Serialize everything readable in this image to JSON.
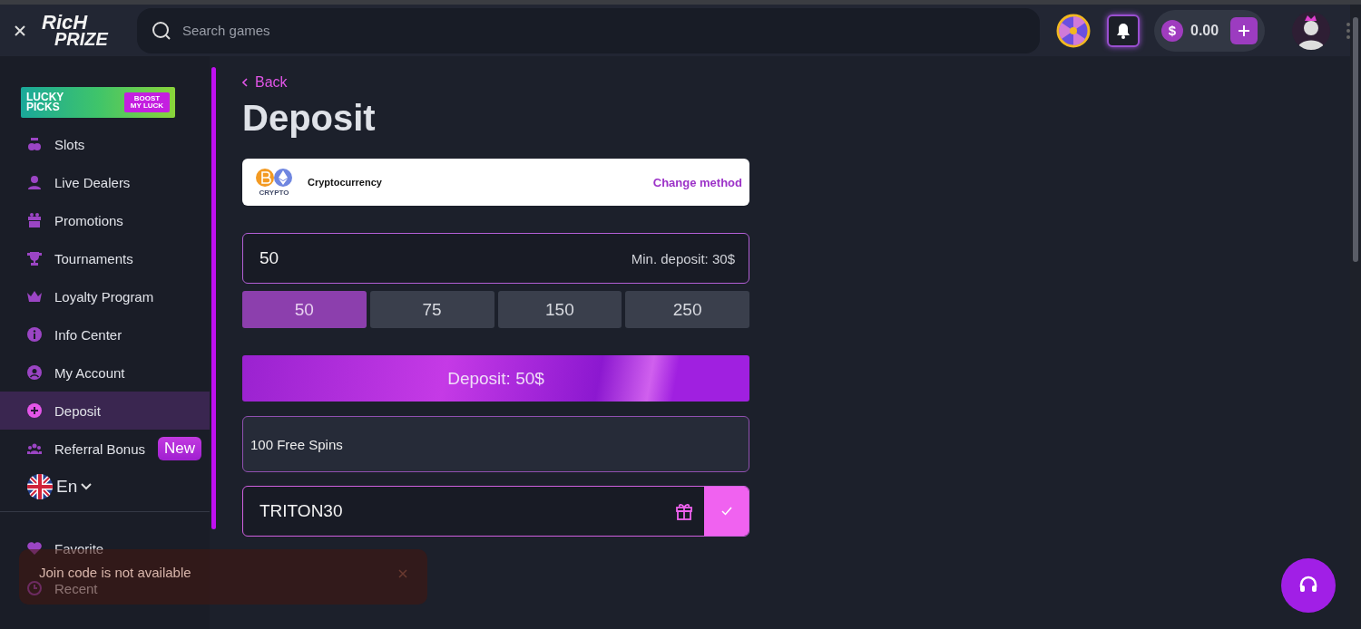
{
  "header": {
    "logo": [
      "RicH",
      "PRIZE"
    ],
    "search": {
      "placeholder": "Search games"
    },
    "currency_symbol": "$",
    "balance": "0.00"
  },
  "sidebar": {
    "banner": {
      "title": "LUCKY PICKS",
      "button": "BOOST MY LUCK"
    },
    "items": [
      {
        "label": "Slots",
        "selected": false
      },
      {
        "label": "Live Dealers",
        "selected": false
      },
      {
        "label": "Promotions",
        "selected": false
      },
      {
        "label": "Tournaments",
        "selected": false
      },
      {
        "label": "Loyalty Program",
        "selected": false
      },
      {
        "label": "Info Center",
        "selected": false
      },
      {
        "label": "My Account",
        "selected": false
      },
      {
        "label": "Deposit",
        "selected": true
      },
      {
        "label": "Referral Bonus",
        "selected": false,
        "badge": "New"
      }
    ],
    "language": "En",
    "secondary_items": [
      {
        "label": "Favorite",
        "selected": false
      },
      {
        "label": "Recent",
        "selected": false
      }
    ]
  },
  "page": {
    "back": "Back",
    "title": "Deposit",
    "method": {
      "logo_caption": "CRYPTO",
      "name": "Cryptocurrency",
      "action": "Change method"
    },
    "amount": {
      "value": "50",
      "hint": "Min. deposit: 30$"
    },
    "presets": [
      {
        "label": "50",
        "selected": true
      },
      {
        "label": "75",
        "selected": false
      },
      {
        "label": "150",
        "selected": false
      },
      {
        "label": "250",
        "selected": false
      }
    ],
    "submit": "Deposit: 50$",
    "bonus": "100 Free Spins",
    "promo_code": {
      "value": "TRITON30"
    }
  },
  "toast": {
    "message": "Join code is not available"
  }
}
